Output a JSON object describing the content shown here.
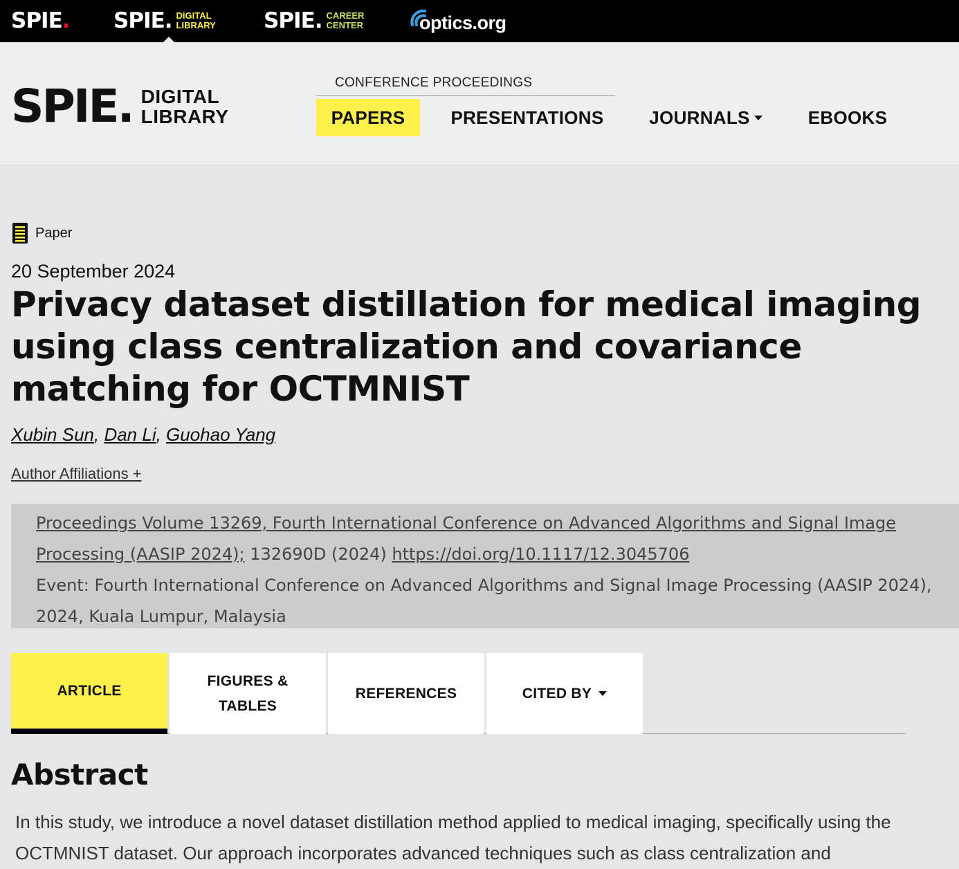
{
  "topbar": {
    "brand_spie": "SPIE",
    "brand_digital_line1": "DIGITAL",
    "brand_digital_line2": "LIBRARY",
    "brand_career_line1": "CAREER",
    "brand_career_line2": "CENTER",
    "brand_optics": "optics.org",
    "colors": {
      "bg": "#000000",
      "red_dot": "#e8112d",
      "yellow": "#fdf04a",
      "green": "#c8e05a",
      "optics_blue": "#3aa0e0"
    }
  },
  "header": {
    "logo_spie": "SPIE",
    "logo_line1": "DIGITAL",
    "logo_line2": "LIBRARY",
    "conf_label": "CONFERENCE PROCEEDINGS",
    "nav": {
      "papers": "PAPERS",
      "presentations": "PRESENTATIONS",
      "journals": "JOURNALS",
      "ebooks": "EBOOKS"
    },
    "accent": "#fdf04a"
  },
  "article": {
    "type_label": "Paper",
    "type_icon": "document-icon",
    "date": "20 September 2024",
    "title": "Privacy dataset distillation for medical imaging using class centralization and covariance matching for OCTMNIST",
    "authors": [
      "Xubin Sun",
      "Dan Li",
      "Guohao Yang"
    ],
    "affiliations_toggle": "Author Affiliations +",
    "proceedings_link": "Proceedings Volume 13269, Fourth International Conference on Advanced Algorithms and Signal Image Processing (AASIP 2024);",
    "article_number": " 132690D (2024) ",
    "doi": "https://doi.org/10.1117/12.3045706",
    "event": "Event: Fourth International Conference on Advanced Algorithms and Signal Image Processing (AASIP 2024), 2024, Kuala Lumpur, Malaysia"
  },
  "tabs": {
    "article": "ARTICLE",
    "figures_line1": "FIGURES &",
    "figures_line2": "TABLES",
    "references": "REFERENCES",
    "cited_by": "CITED BY"
  },
  "abstract": {
    "heading": "Abstract",
    "text": "In this study, we introduce a novel dataset distillation method applied to medical imaging, specifically using the OCTMNIST dataset. Our approach incorporates advanced techniques such as class centralization and"
  }
}
